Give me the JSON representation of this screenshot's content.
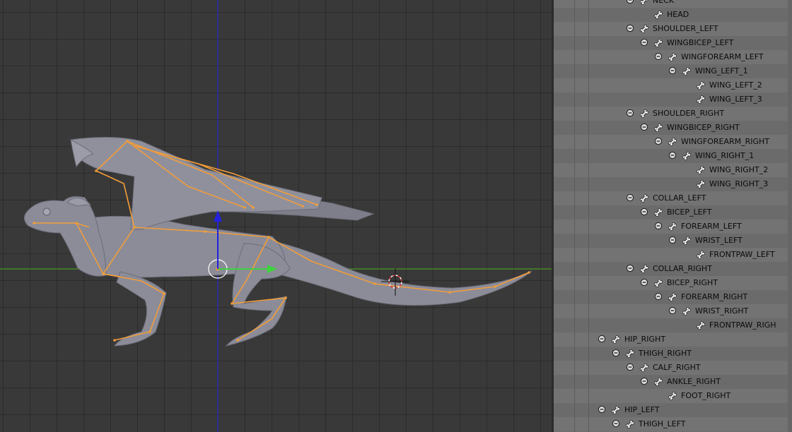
{
  "viewport": {
    "axis_colors": {
      "x": "#4bb31a",
      "y": "#2b2bcc"
    },
    "armature_color": "#f29d3a",
    "mesh_color": "#8a8b97"
  },
  "outliner": {
    "rows": [
      {
        "label": "NECK",
        "depth": 3,
        "has_toggle": true
      },
      {
        "label": "HEAD",
        "depth": 4,
        "has_toggle": false
      },
      {
        "label": "SHOULDER_LEFT",
        "depth": 3,
        "has_toggle": true
      },
      {
        "label": "WINGBICEP_LEFT",
        "depth": 4,
        "has_toggle": true
      },
      {
        "label": "WINGFOREARM_LEFT",
        "depth": 5,
        "has_toggle": true
      },
      {
        "label": "WING_LEFT_1",
        "depth": 6,
        "has_toggle": true
      },
      {
        "label": "WING_LEFT_2",
        "depth": 7,
        "has_toggle": false
      },
      {
        "label": "WING_LEFT_3",
        "depth": 7,
        "has_toggle": false
      },
      {
        "label": "SHOULDER_RIGHT",
        "depth": 3,
        "has_toggle": true
      },
      {
        "label": "WINGBICEP_RIGHT",
        "depth": 4,
        "has_toggle": true
      },
      {
        "label": "WINGFOREARM_RIGHT",
        "depth": 5,
        "has_toggle": true
      },
      {
        "label": "WING_RIGHT_1",
        "depth": 6,
        "has_toggle": true
      },
      {
        "label": "WING_RIGHT_2",
        "depth": 7,
        "has_toggle": false
      },
      {
        "label": "WING_RIGHT_3",
        "depth": 7,
        "has_toggle": false
      },
      {
        "label": "COLLAR_LEFT",
        "depth": 3,
        "has_toggle": true
      },
      {
        "label": "BICEP_LEFT",
        "depth": 4,
        "has_toggle": true
      },
      {
        "label": "FOREARM_LEFT",
        "depth": 5,
        "has_toggle": true
      },
      {
        "label": "WRIST_LEFT",
        "depth": 6,
        "has_toggle": true
      },
      {
        "label": "FRONTPAW_LEFT",
        "depth": 7,
        "has_toggle": false
      },
      {
        "label": "COLLAR_RIGHT",
        "depth": 3,
        "has_toggle": true
      },
      {
        "label": "BICEP_RIGHT",
        "depth": 4,
        "has_toggle": true
      },
      {
        "label": "FOREARM_RIGHT",
        "depth": 5,
        "has_toggle": true
      },
      {
        "label": "WRIST_RIGHT",
        "depth": 6,
        "has_toggle": true
      },
      {
        "label": "FRONTPAW_RIGH",
        "depth": 7,
        "has_toggle": false
      },
      {
        "label": "HIP_RIGHT",
        "depth": 1,
        "has_toggle": true
      },
      {
        "label": "THIGH_RIGHT",
        "depth": 2,
        "has_toggle": true
      },
      {
        "label": "CALF_RIGHT",
        "depth": 3,
        "has_toggle": true
      },
      {
        "label": "ANKLE_RIGHT",
        "depth": 4,
        "has_toggle": true
      },
      {
        "label": "FOOT_RIGHT",
        "depth": 5,
        "has_toggle": false
      },
      {
        "label": "HIP_LEFT",
        "depth": 1,
        "has_toggle": true
      },
      {
        "label": "THIGH_LEFT",
        "depth": 2,
        "has_toggle": true
      }
    ]
  }
}
